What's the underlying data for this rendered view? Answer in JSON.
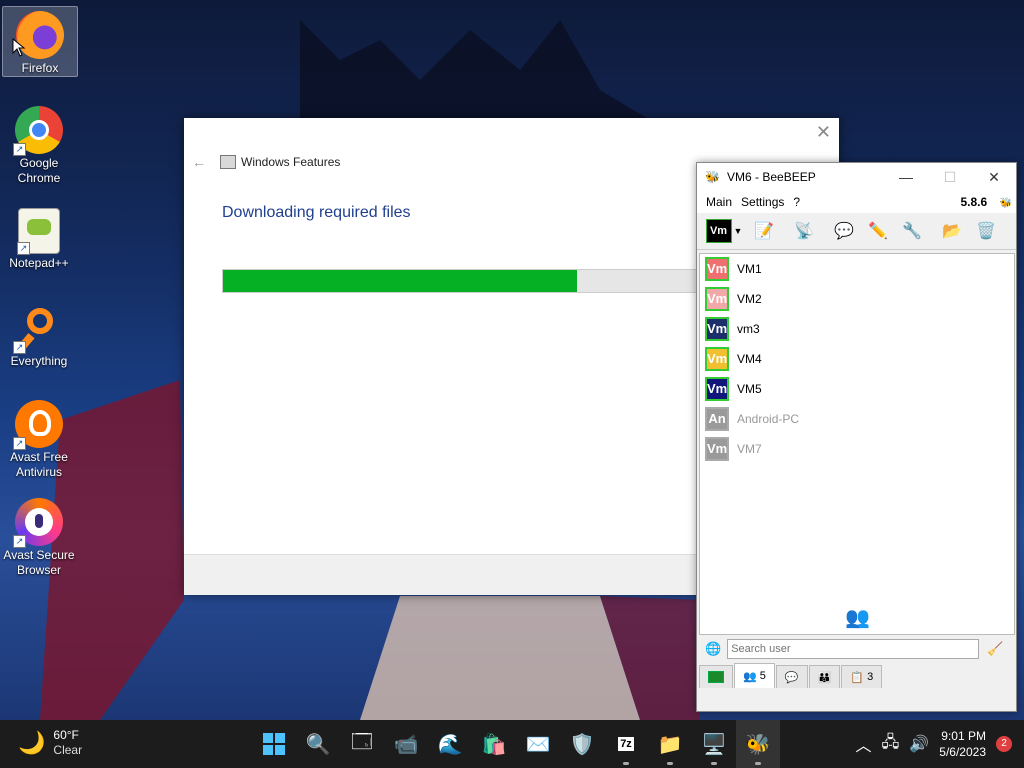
{
  "desktop": {
    "icons": [
      {
        "label": "Firefox",
        "icon": "firefox-icon"
      },
      {
        "label": "Google Chrome",
        "icon": "chrome-icon"
      },
      {
        "label": "Notepad++",
        "icon": "notepadpp-icon"
      },
      {
        "label": "Everything",
        "icon": "everything-icon"
      },
      {
        "label": "Avast Free Antivirus",
        "icon": "avast-icon"
      },
      {
        "label": "Avast Secure Browser",
        "icon": "avast-browser-icon"
      }
    ]
  },
  "windows_features": {
    "title": "Windows Features",
    "heading": "Downloading required files",
    "progress": 0.59
  },
  "beebeep": {
    "title": "VM6 - BeeBEEP",
    "version": "5.8.6",
    "menu": [
      "Main",
      "Settings",
      "?"
    ],
    "status_badge": "Vm",
    "users": [
      {
        "avatar": "Vm",
        "name": "VM1",
        "color": "#f07070",
        "online": true
      },
      {
        "avatar": "Vm",
        "name": "VM2",
        "color": "#f0a8a8",
        "online": true
      },
      {
        "avatar": "Vm",
        "name": "vm3",
        "color": "#1c2f6a",
        "online": true
      },
      {
        "avatar": "Vm",
        "name": "VM4",
        "color": "#f0c030",
        "online": true
      },
      {
        "avatar": "Vm",
        "name": "VM5",
        "color": "#10167a",
        "online": true
      },
      {
        "avatar": "An",
        "name": "Android-PC",
        "color": "#9a9a9a",
        "online": false
      },
      {
        "avatar": "Vm",
        "name": "VM7",
        "color": "#9a9a9a",
        "online": false
      }
    ],
    "search_placeholder": "Search user",
    "tabs": [
      {
        "icon": "screen-icon",
        "count": ""
      },
      {
        "icon": "users-icon",
        "count": "5"
      },
      {
        "icon": "chat-icon",
        "count": ""
      },
      {
        "icon": "groups-icon",
        "count": ""
      },
      {
        "icon": "files-icon",
        "count": "3"
      }
    ]
  },
  "taskbar": {
    "weather": {
      "temp": "60°F",
      "condition": "Clear"
    },
    "time": "9:01 PM",
    "date": "5/6/2023",
    "notifications": "2"
  }
}
